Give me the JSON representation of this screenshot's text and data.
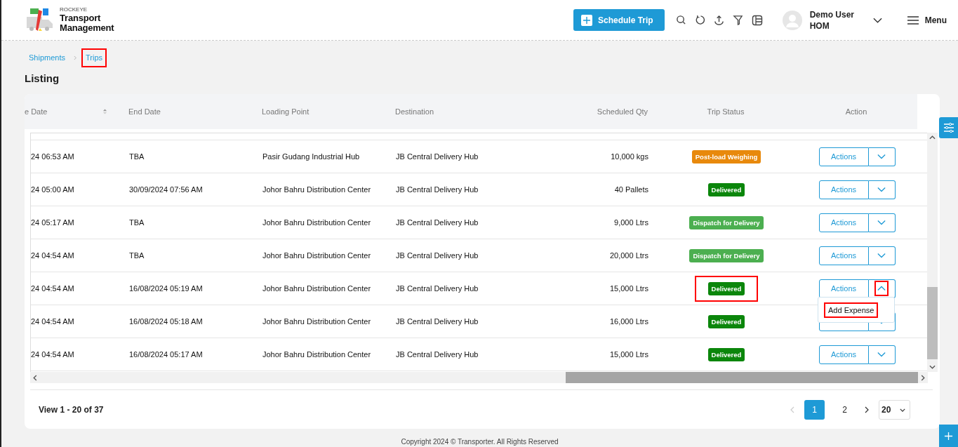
{
  "header": {
    "brand_small": "ROCKEYE",
    "brand_line1": "Transport",
    "brand_line2": "Management",
    "schedule_button": "Schedule Trip",
    "user_name": "Demo User",
    "user_role": "HOM",
    "menu_label": "Menu"
  },
  "breadcrumb": [
    {
      "label": "Shipments",
      "highlighted": false
    },
    {
      "label": "Trips",
      "highlighted": true
    }
  ],
  "page_title": "Listing",
  "table": {
    "columns": [
      {
        "label": "e Date",
        "sortable": true
      },
      {
        "label": "End Date",
        "sortable": false
      },
      {
        "label": "Loading Point",
        "sortable": false
      },
      {
        "label": "Destination",
        "sortable": false
      },
      {
        "label": "Scheduled Qty",
        "sortable": false
      },
      {
        "label": "Trip Status",
        "sortable": false
      },
      {
        "label": "Action",
        "sortable": false
      }
    ],
    "rows": [
      {
        "cells": [
          "24 06:53 AM",
          "TBA",
          "Pasir Gudang Industrial Hub",
          "JB Central Delivery Hub",
          "10,000 kgs"
        ],
        "status": {
          "label": "Post-load Weighing",
          "color": "#e8890c",
          "highlighted": false
        },
        "action": {
          "label": "Actions",
          "expanded": false,
          "highlighted": false
        }
      },
      {
        "cells": [
          "24 05:00 AM",
          "30/09/2024 07:56 AM",
          "Johor Bahru Distribution Center",
          "JB Central Delivery Hub",
          "40 Pallets"
        ],
        "status": {
          "label": "Delivered",
          "color": "#0b860b",
          "highlighted": false
        },
        "action": {
          "label": "Actions",
          "expanded": false,
          "highlighted": false
        }
      },
      {
        "cells": [
          "24 05:17 AM",
          "TBA",
          "Johor Bahru Distribution Center",
          "JB Central Delivery Hub",
          "9,000 Ltrs"
        ],
        "status": {
          "label": "Dispatch for Delivery",
          "color": "#4caf50",
          "highlighted": false
        },
        "action": {
          "label": "Actions",
          "expanded": false,
          "highlighted": false
        }
      },
      {
        "cells": [
          "24 04:54 AM",
          "TBA",
          "Johor Bahru Distribution Center",
          "JB Central Delivery Hub",
          "20,000 Ltrs"
        ],
        "status": {
          "label": "Dispatch for Delivery",
          "color": "#4caf50",
          "highlighted": false
        },
        "action": {
          "label": "Actions",
          "expanded": false,
          "highlighted": false
        }
      },
      {
        "cells": [
          "24 04:54 AM",
          "16/08/2024 05:19 AM",
          "Johor Bahru Distribution Center",
          "JB Central Delivery Hub",
          "15,000 Ltrs"
        ],
        "status": {
          "label": "Delivered",
          "color": "#0b860b",
          "highlighted": true
        },
        "action": {
          "label": "Actions",
          "expanded": true,
          "highlighted": true
        }
      },
      {
        "cells": [
          "24 04:54 AM",
          "16/08/2024 05:18 AM",
          "Johor Bahru Distribution Center",
          "JB Central Delivery Hub",
          "16,000 Ltrs"
        ],
        "status": {
          "label": "Delivered",
          "color": "#0b860b",
          "highlighted": false
        },
        "action": {
          "expanded": false,
          "highlighted": false
        }
      },
      {
        "cells": [
          "24 04:54 AM",
          "16/08/2024 05:17 AM",
          "Johor Bahru Distribution Center",
          "JB Central Delivery Hub",
          "15,000 Ltrs"
        ],
        "status": {
          "label": "Delivered",
          "color": "#0b860b",
          "highlighted": false
        },
        "action": {
          "label": "Actions",
          "expanded": false,
          "highlighted": false
        }
      }
    ]
  },
  "dropdown": {
    "items": [
      {
        "label": "Add Expense",
        "highlighted": true
      }
    ]
  },
  "pagination": {
    "summary": "View 1 - 20 of 37",
    "prev_enabled": false,
    "next_enabled": true,
    "pages": [
      {
        "label": "1",
        "selected": true
      },
      {
        "label": "2",
        "selected": false
      }
    ],
    "page_size": "20"
  },
  "footer": "Copyright 2024 © Transporter. All Rights Reserved"
}
